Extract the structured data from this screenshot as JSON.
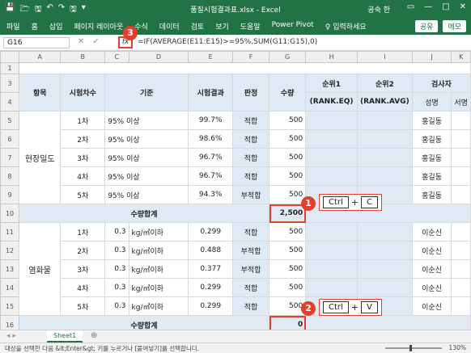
{
  "window": {
    "title": "품질시험결과표.xlsx - Excel",
    "user": "공숙 한",
    "quick_access": [
      "💾",
      "🗁",
      "🖫",
      "↶",
      "↷",
      "🖫",
      "▾"
    ],
    "controls": [
      "▭",
      "—",
      "□",
      "✕"
    ]
  },
  "ribbon": {
    "tabs": [
      "파일",
      "홈",
      "삽입",
      "페이지 레이아웃",
      "수식",
      "데이터",
      "검토",
      "보기",
      "도움말",
      "Power Pivot",
      "♀ 입력하세요"
    ],
    "share": "공유",
    "memo": "메모"
  },
  "formula_bar": {
    "name_box": "G16",
    "cancel": "✕",
    "enter": "✓",
    "fx": "fx",
    "formula": "=IF(AVERAGE(E11:E15)>=95%,SUM(G11:G15),0)"
  },
  "columns": [
    "A",
    "B",
    "C",
    "D",
    "E",
    "F",
    "G",
    "H",
    "I",
    "J",
    "K"
  ],
  "row_numbers": [
    "1",
    "3",
    "4",
    "5",
    "6",
    "7",
    "8",
    "9",
    "10",
    "11",
    "12",
    "13",
    "14",
    "15",
    "16"
  ],
  "headers": {
    "item": "항목",
    "order": "시험차수",
    "criteria": "기준",
    "result": "시험결과",
    "verdict": "판정",
    "qty": "수량",
    "rank1": "순위1",
    "rank1_sub": "(RANK.EQ)",
    "rank2": "순위2",
    "rank2_sub": "(RANK.AVG)",
    "tester": "검사자",
    "name": "성명",
    "sign": "서명"
  },
  "group1": {
    "label": "현장밀도",
    "rows": [
      {
        "order": "1차",
        "criteria": "95% 이상",
        "result": "99.7%",
        "verdict": "적합",
        "qty": "500",
        "tester": "홍길동"
      },
      {
        "order": "2차",
        "criteria": "95% 이상",
        "result": "98.6%",
        "verdict": "적합",
        "qty": "500",
        "tester": "홍길동"
      },
      {
        "order": "3차",
        "criteria": "95% 이상",
        "result": "96.7%",
        "verdict": "적합",
        "qty": "500",
        "tester": "홍길동"
      },
      {
        "order": "4차",
        "criteria": "95% 이상",
        "result": "96.7%",
        "verdict": "적합",
        "qty": "500",
        "tester": "홍길동"
      },
      {
        "order": "5차",
        "criteria": "95% 이상",
        "result": "94.3%",
        "verdict": "부적합",
        "qty": "500",
        "tester": "홍길동"
      }
    ],
    "total_label": "수량합계",
    "total_value": "2,500"
  },
  "group2": {
    "label": "염화물",
    "rows": [
      {
        "order": "1차",
        "criteria_num": "0.3",
        "criteria_unit": "kg/㎥이하",
        "result": "0.299",
        "verdict": "적합",
        "qty": "500",
        "tester": "이순신"
      },
      {
        "order": "2차",
        "criteria_num": "0.3",
        "criteria_unit": "kg/㎥이하",
        "result": "0.488",
        "verdict": "부적합",
        "qty": "500",
        "tester": "이순신"
      },
      {
        "order": "3차",
        "criteria_num": "0.3",
        "criteria_unit": "kg/㎥이하",
        "result": "0.377",
        "verdict": "부적합",
        "qty": "500",
        "tester": "이순신"
      },
      {
        "order": "4차",
        "criteria_num": "0.3",
        "criteria_unit": "kg/㎥이하",
        "result": "0.299",
        "verdict": "적합",
        "qty": "500",
        "tester": "이순신"
      },
      {
        "order": "5차",
        "criteria_num": "0.3",
        "criteria_unit": "kg/㎥이하",
        "result": "0.299",
        "verdict": "적합",
        "qty": "500",
        "tester": "이순신"
      }
    ],
    "total_label": "수량합계",
    "total_value": "0"
  },
  "callouts": {
    "one": {
      "num": "1",
      "key1": "Ctrl",
      "plus": "+",
      "key2": "C"
    },
    "two": {
      "num": "2",
      "key1": "Ctrl",
      "plus": "+",
      "key2": "V"
    },
    "three": {
      "num": "3"
    }
  },
  "sheet_tabs": {
    "active": "Sheet1",
    "add": "⊕",
    "nav": "◂ ▸"
  },
  "status_bar": {
    "message": "대상을 선택한 다음 &lt;Enter&gt; 키를 누르거나 [붙여넣기]를 선택합니다.",
    "zoom": "130%"
  },
  "colors": {
    "excel_green": "#217346",
    "highlight_red": "#e43f2b",
    "header_fill": "#dfeaf5"
  }
}
